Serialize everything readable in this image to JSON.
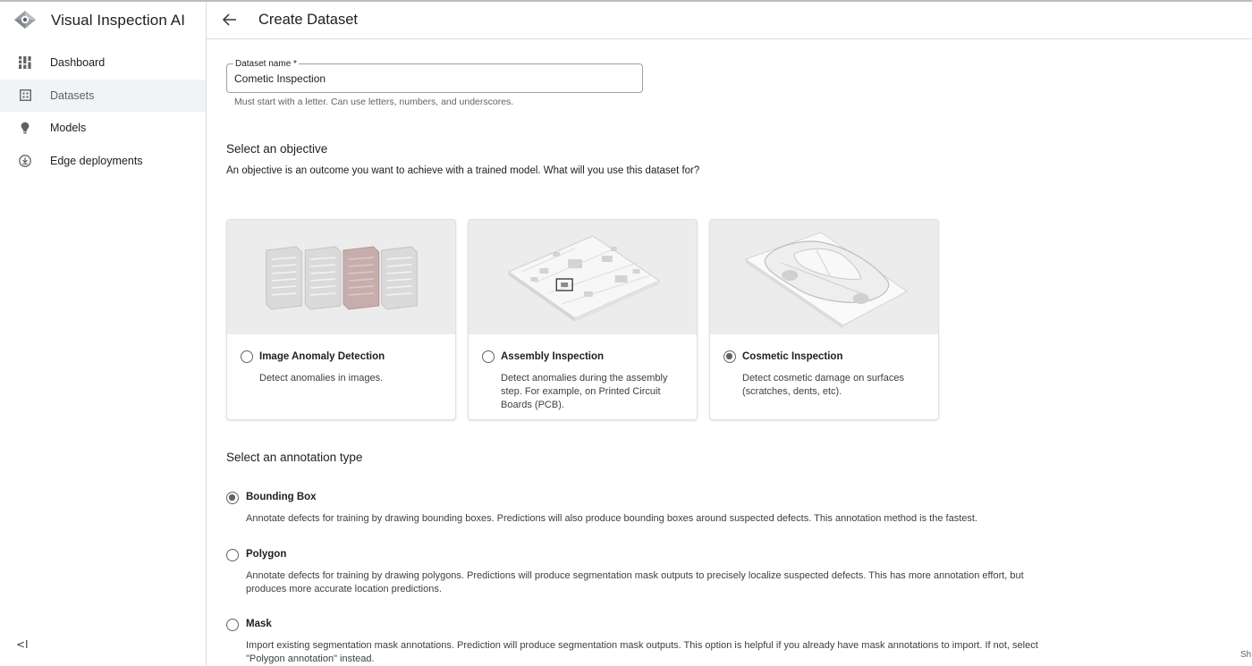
{
  "app": {
    "title": "Visual Inspection AI"
  },
  "sidebar": {
    "items": [
      {
        "label": "Dashboard",
        "icon": "dashboard-icon",
        "active": false
      },
      {
        "label": "Datasets",
        "icon": "datasets-icon",
        "active": true
      },
      {
        "label": "Models",
        "icon": "lightbulb-icon",
        "active": false
      },
      {
        "label": "Edge deployments",
        "icon": "download-icon",
        "active": false
      }
    ],
    "collapse_label": "<I"
  },
  "header": {
    "title": "Create Dataset"
  },
  "form": {
    "name_label": "Dataset name *",
    "name_value": "Cometic Inspection",
    "name_hint": "Must start with a letter. Can use letters, numbers, and underscores."
  },
  "objective": {
    "title": "Select an objective",
    "description": "An objective is an outcome you want to achieve with a trained model. What will you use this dataset for?",
    "options": [
      {
        "title": "Image Anomaly Detection",
        "description": "Detect anomalies in images.",
        "selected": false
      },
      {
        "title": "Assembly Inspection",
        "description": "Detect anomalies during the assembly step. For example, on Printed Circuit Boards (PCB).",
        "selected": false
      },
      {
        "title": "Cosmetic Inspection",
        "description": "Detect cosmetic damage on surfaces (scratches, dents, etc).",
        "selected": true
      }
    ]
  },
  "annotation": {
    "title": "Select an annotation type",
    "options": [
      {
        "title": "Bounding Box",
        "description": "Annotate defects for training by drawing bounding boxes. Predictions will also produce bounding boxes around suspected defects. This annotation method is the fastest.",
        "selected": true
      },
      {
        "title": "Polygon",
        "description": "Annotate defects for training by drawing polygons. Predictions will produce segmentation mask outputs to precisely localize suspected defects. This has more annotation effort, but produces more accurate location predictions.",
        "selected": false
      },
      {
        "title": "Mask",
        "description": "Import existing segmentation mask annotations. Prediction will produce segmentation mask outputs. This option is helpful if you already have mask annotations to import. If not, select \"Polygon annotation\" instead.",
        "selected": false
      }
    ]
  },
  "footer": {
    "corner_text": "Sh"
  },
  "colors": {
    "accent": "#5f6368",
    "active_nav_bg": "#f1f3f4",
    "divider": "#dadce0"
  }
}
